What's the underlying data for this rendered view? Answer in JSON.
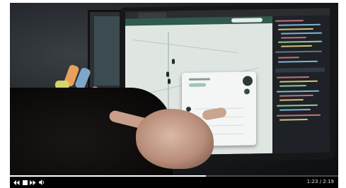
{
  "player": {
    "time_display": "1:23 / 2:19",
    "progress": 0.597,
    "colors": {
      "track": "#4c4c4c",
      "fill": "#ffffff",
      "bar": "#000000"
    },
    "icons": {
      "rewind": "rewind-icon",
      "stop": "stop-icon",
      "forward": "fast-forward-icon",
      "volume": "volume-icon"
    }
  },
  "frame": {
    "icons": {
      "map_pin": "map-pin-icon",
      "avatar": "avatar-icon"
    }
  }
}
